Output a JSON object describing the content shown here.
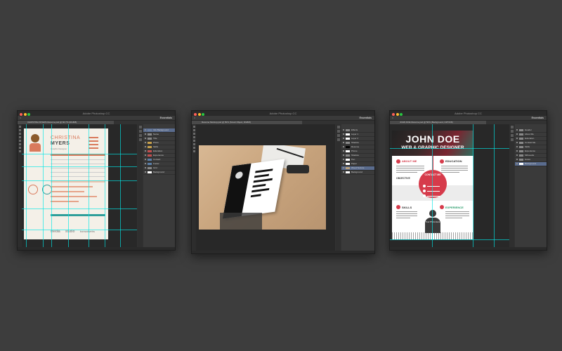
{
  "screen": {
    "background": "#3d3d3d"
  },
  "win1": {
    "titlebar": "Adobe Photoshop CC",
    "workspace": "Essentials",
    "doc_tab": "CHRISTINA MYERS Resume.psd @ 66.7% (RGB/8)",
    "layers": [
      {
        "name": "Info Background",
        "color": "#6a7fa0",
        "active": true
      },
      {
        "name": "Name",
        "color": "#888888"
      },
      {
        "name": "Title",
        "color": "#888888"
      },
      {
        "name": "Photo",
        "color": "#c7a04b"
      },
      {
        "name": "Skills",
        "color": "#c7a04b"
      },
      {
        "name": "Education",
        "color": "#c44e4e"
      },
      {
        "name": "Experience",
        "color": "#c44e4e"
      },
      {
        "name": "Contact",
        "color": "#5a7fa8"
      },
      {
        "name": "Footer",
        "color": "#5a7fa8"
      },
      {
        "name": "Grid",
        "color": "#888888"
      },
      {
        "name": "Background",
        "color": "#ffffff"
      }
    ],
    "resume": {
      "first_name": "CHRISTINA",
      "last_name": "MYERS",
      "tagline": "Graphic Designer",
      "logos": [
        "media",
        "studio",
        "bonsaiwebs"
      ],
      "accent": "#d97a5c",
      "accent2": "#2f9e9a"
    }
  },
  "win2": {
    "titlebar": "Adobe Photoshop CC",
    "workspace": "Essentials",
    "doc_tab": "Resume Mockup.psd @ 50% (Smart Object, RGB/8)",
    "layers": [
      {
        "name": "Effects",
        "color": "#888888"
      },
      {
        "name": "Layer 1",
        "color": "#ffffff"
      },
      {
        "name": "Layer 2",
        "color": "#ffffff"
      },
      {
        "name": "Shadow",
        "color": "#888888"
      },
      {
        "name": "Resume",
        "color": "#000000"
      },
      {
        "name": "Phone",
        "color": "#ffffff"
      },
      {
        "name": "Shadow",
        "color": "#888888"
      },
      {
        "name": "Pen",
        "color": "#ffffff"
      },
      {
        "name": "Paper",
        "color": "#ffffff"
      },
      {
        "name": "Wood Texture",
        "color": "#b9a07a",
        "active": true
      },
      {
        "name": "Background",
        "color": "#ffffff"
      }
    ]
  },
  "win3": {
    "titlebar": "Adobe Photoshop CC",
    "workspace": "Essentials",
    "doc_tab": "JOHN DOE Resume.psd @ 50% (Background, CMYK/8)",
    "layers": [
      {
        "name": "Header",
        "color": "#888888"
      },
      {
        "name": "About Me",
        "color": "#888888"
      },
      {
        "name": "Education",
        "color": "#888888"
      },
      {
        "name": "Contact Me",
        "color": "#888888"
      },
      {
        "name": "Skills",
        "color": "#888888"
      },
      {
        "name": "Experience",
        "color": "#888888"
      },
      {
        "name": "Silhouette",
        "color": "#888888"
      },
      {
        "name": "Grass",
        "color": "#888888"
      },
      {
        "name": "Background",
        "color": "#ffffff",
        "active": true
      }
    ],
    "resume": {
      "name": "JOHN DOE",
      "title": "WEB & GRAPHIC DESIGNER",
      "sections": [
        "ABOUT ME",
        "EDUCATION",
        "OBJECTIVE",
        "CONTACT ME",
        "SKILLS",
        "EXPERIENCE"
      ],
      "silhouette_text": "Your Photo Here",
      "accent": "#d63b4b"
    }
  }
}
